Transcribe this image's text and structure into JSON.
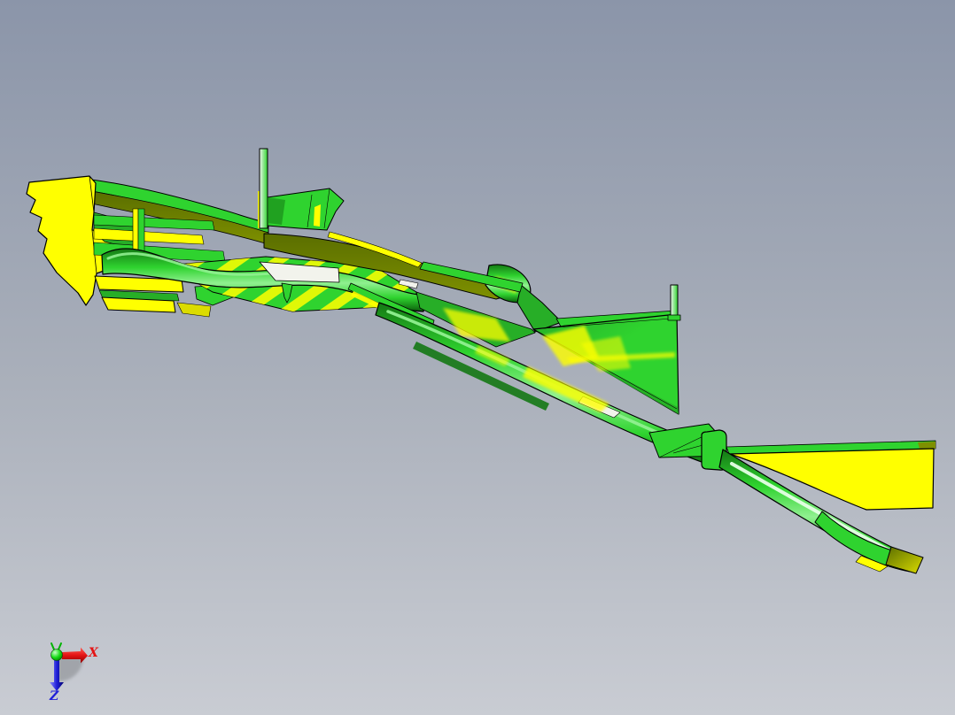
{
  "viewport": {
    "kind": "3d-cad-viewport",
    "axis_triad": {
      "x_label": "X",
      "z_label": "Z"
    }
  },
  "colors": {
    "bg_top": "#8B95A9",
    "bg_mid": "#A9AFBA",
    "bg_bottom": "#C9CCD3",
    "part_green": "#2FD32F",
    "part_green_mid": "#27AE27",
    "part_green_dark": "#147814",
    "part_green_deep": "#0B5E0B",
    "part_green_light": "#90F090",
    "part_white_glint": "#F2F3EC",
    "part_olive": "#7E9000",
    "part_olive_dark": "#5A6E00",
    "part_yellow": "#FFFF00",
    "part_yellow_deep": "#DCDC00",
    "edge_black": "#000000",
    "axis_x_red": "#E41414",
    "axis_z_blue": "#2020D8",
    "axis_y_green": "#00B400",
    "origin_green": "#17DD17",
    "triad_shadow_gray": "#7F8286"
  }
}
